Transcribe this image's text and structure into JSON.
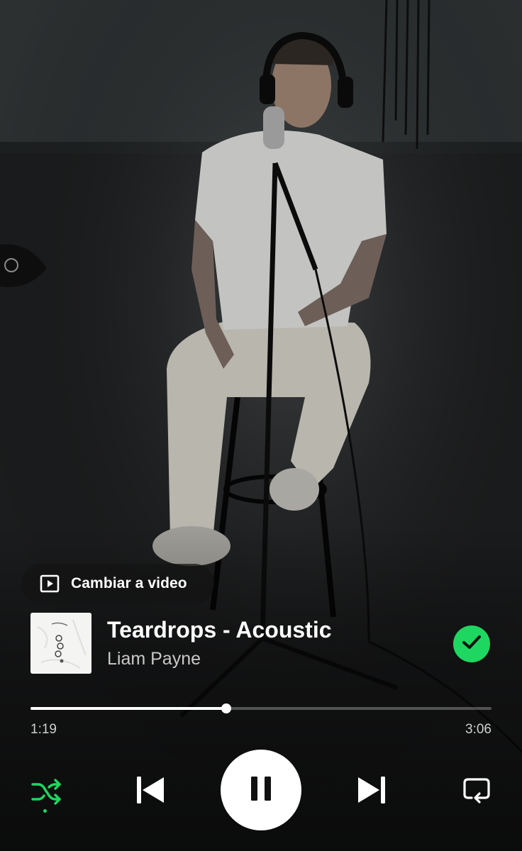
{
  "video_toggle": {
    "label": "Cambiar a video"
  },
  "track": {
    "title": "Teardrops - Acoustic",
    "artist": "Liam Payne",
    "liked": true
  },
  "playback": {
    "elapsed": "1:19",
    "duration": "3:06",
    "progress_fraction": 0.425,
    "state": "playing",
    "shuffle": true,
    "repeat": false
  },
  "colors": {
    "accent": "#1ed760",
    "background": "#1a1a1a"
  },
  "icons": {
    "video": "video-play-icon",
    "liked": "check-icon",
    "shuffle": "shuffle-icon",
    "prev": "skip-previous-icon",
    "play": "pause-icon",
    "next": "skip-next-icon",
    "repeat": "repeat-icon"
  }
}
